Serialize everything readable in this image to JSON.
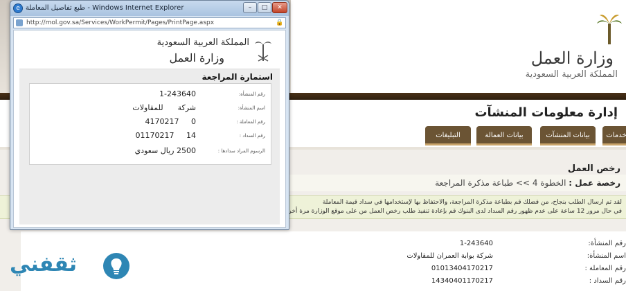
{
  "popup": {
    "title": "طبع تفاصيل المعاملة - Windows Internet Explorer",
    "url": "http://mol.gov.sa/Services/WorkPermit/Pages/PrintPage.aspx",
    "header_calligraphy_1": "المملكة العربية السعودية",
    "header_calligraphy_2": "وزارة العمل",
    "form_title": "استمارة المراجعة",
    "fields": [
      {
        "label": "رقم المنشأة:",
        "value": "1-243640"
      },
      {
        "label": "اسم المنشأة:",
        "value": "شركة ‌ ‌ ‌ ‌ ‌ للمقاولات"
      },
      {
        "label": "رقم المعاملة :",
        "value": "0‌‌‌‌ ‌ ‌ ‌ ‌ 4170217"
      },
      {
        "label": "رقم السداد :",
        "value": "14‌ ‌ ‌ ‌ ‌ 01170217"
      },
      {
        "label": "الرسوم المراد سدادها :",
        "value": "2500 ريال سعودي"
      }
    ],
    "buttons": {
      "minimize": "–",
      "maximize": "□",
      "close": "✕"
    }
  },
  "site": {
    "logo_title": "وزارة العمل",
    "logo_subtitle": "المملكة العربية السعودية",
    "section_title": "إدارة معلومات المنشآت",
    "tabs": [
      "التبليغات",
      "بيانات العمالة",
      "بيانات المنشآت",
      "خدمات"
    ],
    "permits_heading": "رخص العمل",
    "breadcrumb_prefix": "رخصة عمل :",
    "breadcrumb_step": "الخطوة 4 >> طباعة مذكرة المراجعة",
    "notice_line1": "لقد تم ارسال الطلب بنجاح، من فضلك قم بطباعة مذكرة المراجعة، والاحتفاظ بها لإستخدامها في سداد قيمة المعاملة",
    "notice_line2": "في حال مرور 12 ساعة على عدم ظهور رقم السداد لدى البنوك قم بإعادة تنفيذ طلب رخص العمل من على موقع الوزارة مرة أخرى العمل ..",
    "details": [
      {
        "label": "رقم المنشأة:",
        "value": "1-243640"
      },
      {
        "label": "اسم المنشأة:",
        "value": "شركة بوابة العمران للمقاولات"
      },
      {
        "label": "رقم المعاملة :",
        "value": "01013404170217"
      },
      {
        "label": "رقم السداد :",
        "value": "14340401170217"
      }
    ],
    "brand_text": "ثقفني"
  },
  "colors": {
    "tab_brown": "#6b5434",
    "band_dark": "#2e1e0e",
    "brand_blue": "#2e86b4"
  }
}
